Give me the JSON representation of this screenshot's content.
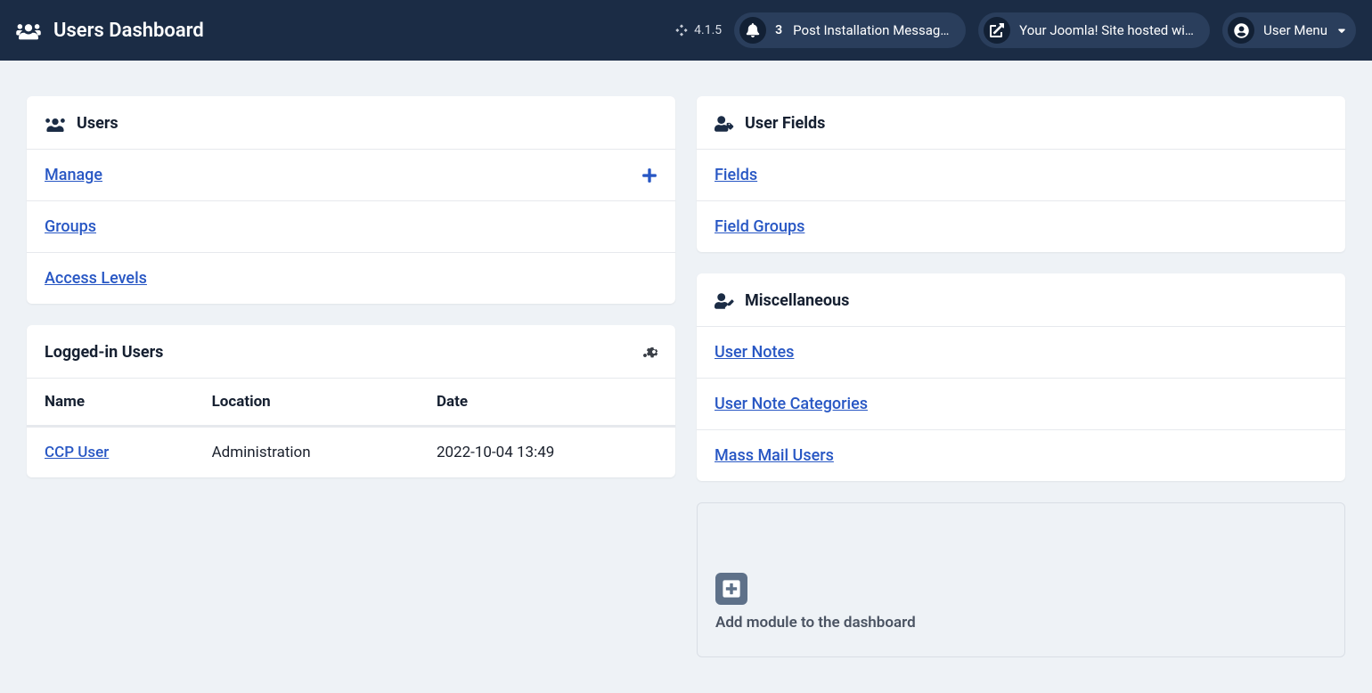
{
  "header": {
    "title": "Users Dashboard",
    "version": "4.1.5",
    "notifications": {
      "count": "3",
      "label": "Post Installation Messages"
    },
    "site_link_label": "Your Joomla! Site hosted wit...",
    "user_menu_label": "User Menu"
  },
  "cards": {
    "users": {
      "title": "Users",
      "items": {
        "manage": "Manage",
        "groups": "Groups",
        "access_levels": "Access Levels"
      }
    },
    "logged_in": {
      "title": "Logged-in Users",
      "columns": {
        "name": "Name",
        "location": "Location",
        "date": "Date"
      },
      "rows": [
        {
          "name": "CCP User",
          "location": "Administration",
          "date": "2022-10-04 13:49"
        }
      ]
    },
    "user_fields": {
      "title": "User Fields",
      "items": {
        "fields": "Fields",
        "field_groups": "Field Groups"
      }
    },
    "misc": {
      "title": "Miscellaneous",
      "items": {
        "user_notes": "User Notes",
        "user_note_categories": "User Note Categories",
        "mass_mail": "Mass Mail Users"
      }
    },
    "add_module": {
      "label": "Add module to the dashboard"
    }
  }
}
